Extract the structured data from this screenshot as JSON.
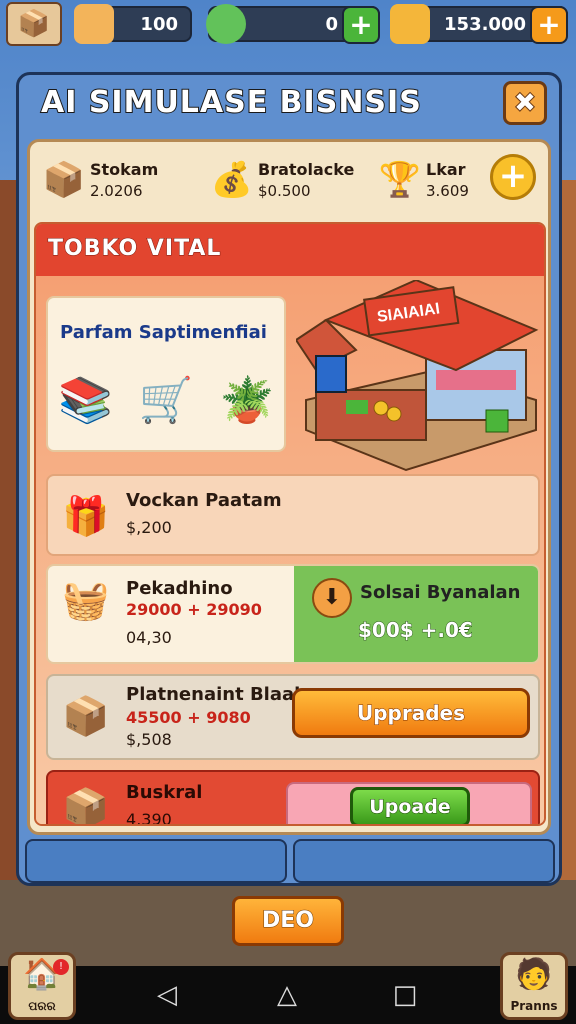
{
  "topbar": {
    "resource1_value": "100",
    "resource2_value": "0",
    "resource3_value": "153.000",
    "plus_label": "+"
  },
  "panel": {
    "title": "AI SIMULASE BISNSIS",
    "close_label": "✖"
  },
  "stats": [
    {
      "icon": "📦",
      "label": "Stokam",
      "value": "2.0206"
    },
    {
      "icon": "💰",
      "label": "Bratolacke",
      "value": "$0.500"
    },
    {
      "icon": "🏆",
      "label": "Lkar",
      "value": "3.609"
    }
  ],
  "stats_add_label": "+",
  "shop": {
    "header": "TOBKO VITAL",
    "category_title": "Parfam Saptimenfiai",
    "stand_sign": "SIAIAIAI",
    "rows": {
      "r1": {
        "name": "Vockan Paatam",
        "price": "$,200"
      },
      "r2": {
        "name": "Pekadhino",
        "price": "29000 + 29090",
        "sub": "04,30",
        "side_title": "Solsai Byanalan",
        "side_value": "$00$ +.0€"
      },
      "r3": {
        "name": "Platnenaint Blaak",
        "price": "45500 + 9080",
        "sub": "$,508",
        "button": "Upprades"
      },
      "r4": {
        "name": "Buskral",
        "price": "4,390",
        "button": "Upoade"
      }
    }
  },
  "video_button": "DEO",
  "corner_left_label": "ପରର",
  "corner_right_label": "Pranns",
  "colors": {
    "accent_orange": "#f07b10",
    "accent_green": "#3a9a1a",
    "header_red": "#e2452f",
    "panel_blue": "#5f8fcf"
  }
}
